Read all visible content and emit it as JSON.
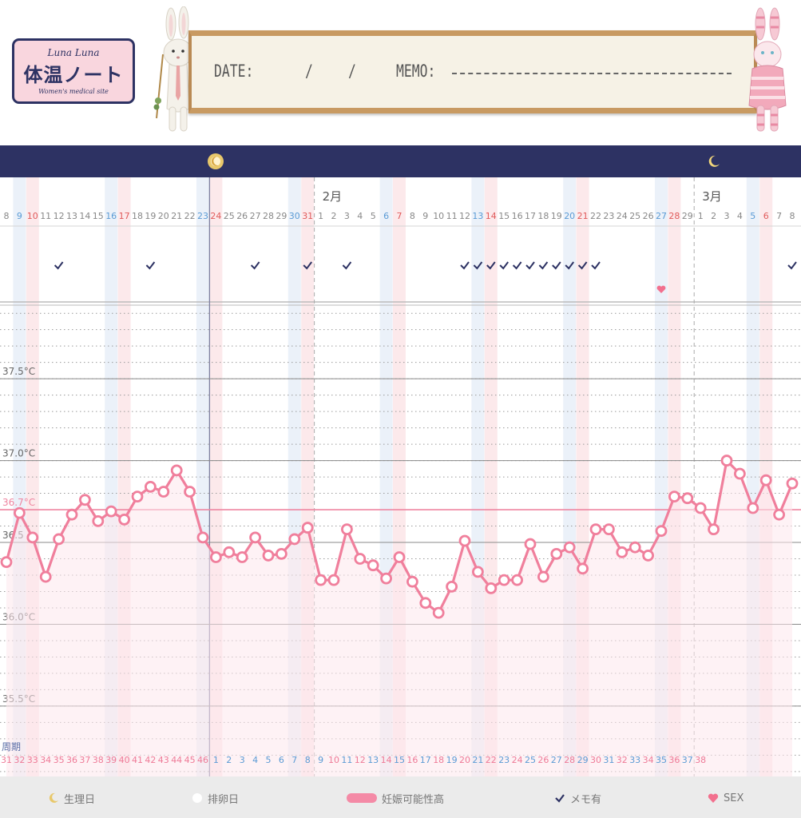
{
  "header": {
    "logo": {
      "brand": "Luna Luna",
      "title": "体温ノート",
      "subtitle": "Women's medical site"
    },
    "memo": {
      "date_label": "DATE:",
      "slash1": "/",
      "slash2": "/",
      "memo_label": "MEMO:"
    }
  },
  "colors": {
    "navy": "#2d3263",
    "temp_line": "#f07f9c",
    "temp_fill": "#fde7ec",
    "ref_line": "#ef86a1",
    "weekend_sat": "#e8eef8",
    "weekend_sun": "#fbe5e8",
    "sat_text": "#5b9bd5",
    "sun_text": "#e05b5b",
    "day_text": "#888888",
    "moon": "#e8c86b",
    "heart": "#f2708e"
  },
  "chart_data": {
    "type": "line",
    "title": "",
    "xlabel": "",
    "ylabel": "",
    "ylim": [
      35.07,
      37.94
    ],
    "yticks": [
      {
        "value": 37.5,
        "label": "37.5°C"
      },
      {
        "value": 37.0,
        "label": "37.0°C"
      },
      {
        "value": 36.5,
        "label": "36.5"
      },
      {
        "value": 36.0,
        "label": "36.0°C"
      },
      {
        "value": 35.5,
        "label": "35.5°C"
      }
    ],
    "reference_line": {
      "value": 36.7,
      "label": "36.7°C"
    },
    "month_labels": [
      {
        "index": 24,
        "label": "2月"
      },
      {
        "index": 53,
        "label": "3月"
      }
    ],
    "day_labels": [
      "8",
      "9",
      "10",
      "11",
      "12",
      "13",
      "14",
      "15",
      "16",
      "17",
      "18",
      "19",
      "20",
      "21",
      "22",
      "23",
      "24",
      "25",
      "26",
      "27",
      "28",
      "29",
      "30",
      "31",
      "1",
      "2",
      "3",
      "4",
      "5",
      "6",
      "7",
      "8",
      "9",
      "10",
      "11",
      "12",
      "13",
      "14",
      "15",
      "16",
      "17",
      "18",
      "19",
      "20",
      "21",
      "22",
      "23",
      "24",
      "25",
      "26",
      "27",
      "28",
      "29",
      "1",
      "2",
      "3",
      "4",
      "5",
      "6",
      "7",
      "8"
    ],
    "day_types": [
      "n",
      "s",
      "u",
      "n",
      "n",
      "n",
      "n",
      "n",
      "s",
      "u",
      "n",
      "n",
      "n",
      "n",
      "n",
      "s",
      "u",
      "n",
      "n",
      "n",
      "n",
      "n",
      "s",
      "u",
      "n",
      "n",
      "n",
      "n",
      "n",
      "s",
      "u",
      "n",
      "n",
      "n",
      "n",
      "n",
      "s",
      "u",
      "n",
      "n",
      "n",
      "n",
      "n",
      "s",
      "u",
      "n",
      "n",
      "n",
      "n",
      "n",
      "s",
      "u",
      "n",
      "n",
      "n",
      "n",
      "n",
      "s",
      "u",
      "n",
      "n"
    ],
    "cycle_label": "周期",
    "cycle_days": [
      "31",
      "32",
      "33",
      "34",
      "35",
      "36",
      "37",
      "38",
      "39",
      "40",
      "41",
      "42",
      "43",
      "44",
      "45",
      "46",
      "1",
      "2",
      "3",
      "4",
      "5",
      "6",
      "7",
      "8",
      "9",
      "10",
      "11",
      "12",
      "13",
      "14",
      "15",
      "16",
      "17",
      "18",
      "19",
      "20",
      "21",
      "22",
      "23",
      "24",
      "25",
      "26",
      "27",
      "28",
      "29",
      "30",
      "31",
      "32",
      "33",
      "34",
      "35",
      "36",
      "37",
      "38"
    ],
    "cycle_start_index": 0,
    "cycle_reset_index": 16,
    "period_start_index": 16,
    "period_start_index_2": 54,
    "memo_indices": [
      4,
      11,
      19,
      23,
      26,
      35,
      36,
      37,
      38,
      39,
      40,
      41,
      42,
      43,
      44,
      45
    ],
    "memo_extra": [
      60
    ],
    "sex_indices": [
      50
    ],
    "temperatures": [
      36.38,
      36.68,
      36.53,
      36.29,
      36.52,
      36.67,
      36.76,
      36.63,
      36.69,
      36.64,
      36.78,
      36.84,
      36.81,
      36.94,
      36.81,
      36.53,
      36.41,
      36.44,
      36.41,
      36.53,
      36.42,
      36.43,
      36.52,
      36.59,
      36.27,
      36.27,
      36.58,
      36.4,
      36.36,
      36.28,
      36.41,
      36.26,
      36.13,
      36.07,
      36.23,
      36.51,
      36.32,
      36.22,
      36.27,
      36.27,
      36.49,
      36.29,
      36.43,
      36.47,
      36.34,
      36.58,
      36.58,
      36.44,
      36.47,
      36.42,
      36.57,
      36.78,
      36.77,
      36.71,
      36.58,
      37.0,
      36.92,
      36.71,
      36.88,
      36.67,
      36.86
    ]
  },
  "legend": {
    "period": "生理日",
    "ovulation": "排卵日",
    "fertile": "妊娠可能性高",
    "memo": "メモ有",
    "sex": "SEX"
  }
}
